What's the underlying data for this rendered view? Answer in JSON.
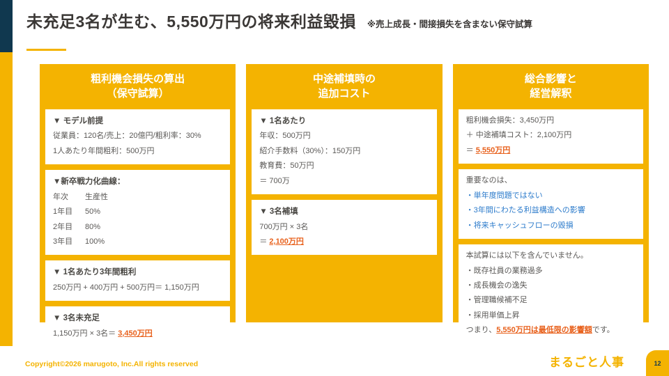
{
  "slide": {
    "title": "未充足3名が生む、5,550万円の将来利益毀損",
    "subtitle": "※売上成長・間接損失を含まない保守試算",
    "copyright": "Copyright©2026 marugoto, Inc.All rights reserved",
    "logo": "まるごと人事",
    "page_number": "12"
  },
  "colors": {
    "brand_yellow": "#F4B301",
    "accent_navy": "#10384F",
    "highlight_orange": "#E8611C",
    "bullet_blue": "#2C7BCB"
  },
  "col1": {
    "header_line1": "粗利機会損失の算出",
    "header_line2": "（保守試算）",
    "box1": {
      "title": "▼ モデル前提",
      "line1": "従業員：120名/売上：20億円/粗利率：30%",
      "line2": "1人あたり年間粗利：500万円"
    },
    "box2": {
      "title": "▼新卒戦力化曲線：",
      "head": [
        "年次",
        "生産性"
      ],
      "rows": [
        [
          "1年目",
          "50%"
        ],
        [
          "2年目",
          "80%"
        ],
        [
          "3年目",
          "100%"
        ]
      ]
    },
    "box3": {
      "title": "▼ 1名あたり3年間粗利",
      "line1": "250万円 + 400万円 + 500万円＝ 1,150万円"
    },
    "box4": {
      "title": "▼ 3名未充足",
      "prefix": "1,150万円 × 3名＝ ",
      "highlight": "3,450万円"
    }
  },
  "col2": {
    "header_line1": "中途補填時の",
    "header_line2": "追加コスト",
    "box1": {
      "title": "▼ 1名あたり",
      "line1": "年収：500万円",
      "line2": "紹介手数料（30%）：150万円",
      "line3": "教育費：50万円",
      "line4": "＝ 700万"
    },
    "box2": {
      "title": "▼ 3名補填",
      "line1": "700万円 × 3名",
      "prefix": "＝ ",
      "highlight": "2,100万円"
    }
  },
  "col3": {
    "header_line1": "総合影響と",
    "header_line2": "経営解釈",
    "box1": {
      "line1": "粗利機会損失：3,450万円",
      "line2": "＋ 中途補填コスト：2,100万円",
      "prefix": "＝ ",
      "highlight": "5,550万円"
    },
    "box2": {
      "intro": "重要なのは、",
      "bullets": [
        "・単年度問題ではない",
        "・3年間にわたる利益構造への影響",
        "・将来キャッシュフローの毀損"
      ]
    },
    "box3": {
      "intro": "本試算には以下を含んでいません。",
      "bullets": [
        "・既存社員の業務過多",
        "・成長機会の逸失",
        "・管理職候補不足",
        "・採用単価上昇"
      ],
      "conclusion_prefix": "つまり、",
      "conclusion_highlight": "5,550万円は最低限の影響額",
      "conclusion_suffix": "です。"
    }
  }
}
